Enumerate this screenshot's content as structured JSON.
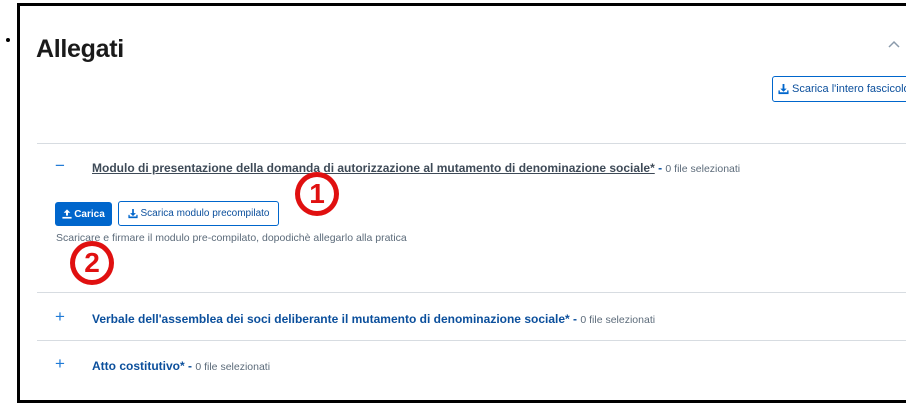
{
  "section": {
    "title": "Allegati",
    "download_all_label": "Scarica l'intero fascicolo"
  },
  "rows": [
    {
      "toggle": "−",
      "title": "Modulo di presentazione della domanda di autorizzazione al mutamento di denominazione sociale*",
      "dash": " - ",
      "count": "0 file selezionati",
      "upload_label": "Carica",
      "download_template_label": "Scarica modulo precompilato",
      "hint": "Scaricare e firmare il modulo pre-compilato, dopodichè allegarlo alla pratica"
    },
    {
      "toggle": "+",
      "title": "Verbale dell'assemblea dei soci deliberante il mutamento di denominazione sociale*",
      "dash": " - ",
      "count": "0 file selezionati"
    },
    {
      "toggle": "+",
      "title": "Atto costitutivo*",
      "dash": " - ",
      "count": "0 file selezionati"
    }
  ],
  "markers": [
    "1",
    "2"
  ],
  "colors": {
    "primary": "#0066cc",
    "link": "#0b4f9c",
    "marker": "#e01010"
  },
  "icons": {
    "collapse": "chevron-up-icon",
    "download": "download-icon",
    "upload": "upload-icon"
  }
}
